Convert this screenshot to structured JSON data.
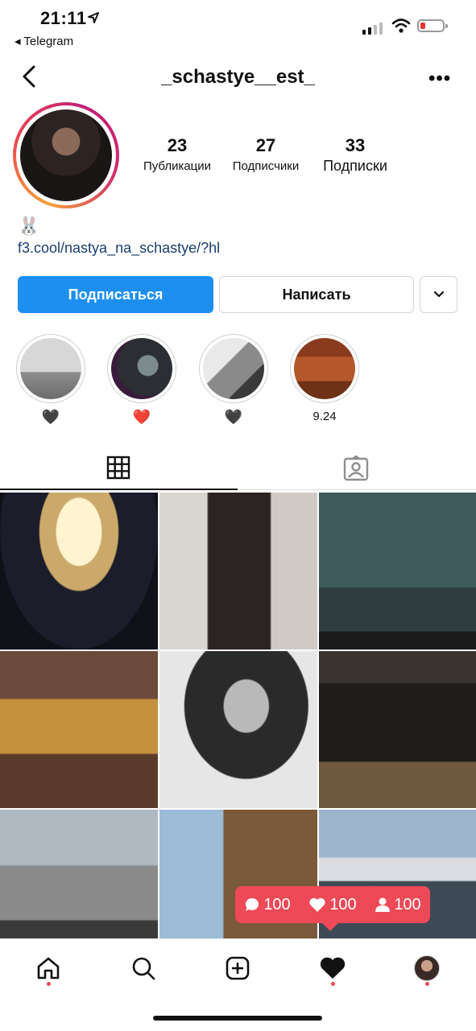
{
  "status_bar": {
    "time": "21:11",
    "back_app": "◂ Telegram",
    "battery_color": "#e5372d"
  },
  "header": {
    "username": "_schastye__est_",
    "back_icon": "chevron-left-icon",
    "more_icon": "more-horizontal-icon"
  },
  "profile": {
    "stats": [
      {
        "value": "23",
        "label": "Публикации"
      },
      {
        "value": "27",
        "label": "Подписчики"
      },
      {
        "value": "33",
        "label": "Подписки"
      }
    ],
    "bio_emoji": "🐰",
    "link": "f3.cool/nastya_na_schastye/?hl"
  },
  "actions": {
    "follow_label": "Подписаться",
    "message_label": "Написать",
    "follow_color": "#1e8ff2"
  },
  "highlights": [
    {
      "caption": "🖤"
    },
    {
      "caption": "❤️"
    },
    {
      "caption": "🖤"
    },
    {
      "caption": "9.24"
    }
  ],
  "tabs": {
    "active": "grid",
    "items": [
      "grid-icon",
      "tagged-icon"
    ]
  },
  "notification": {
    "comments": "100",
    "likes": "100",
    "followers": "100",
    "color": "#ed4956"
  },
  "bottom_nav": {
    "items": [
      "home-icon",
      "search-icon",
      "new-post-icon",
      "activity-heart-icon",
      "profile-avatar"
    ]
  }
}
